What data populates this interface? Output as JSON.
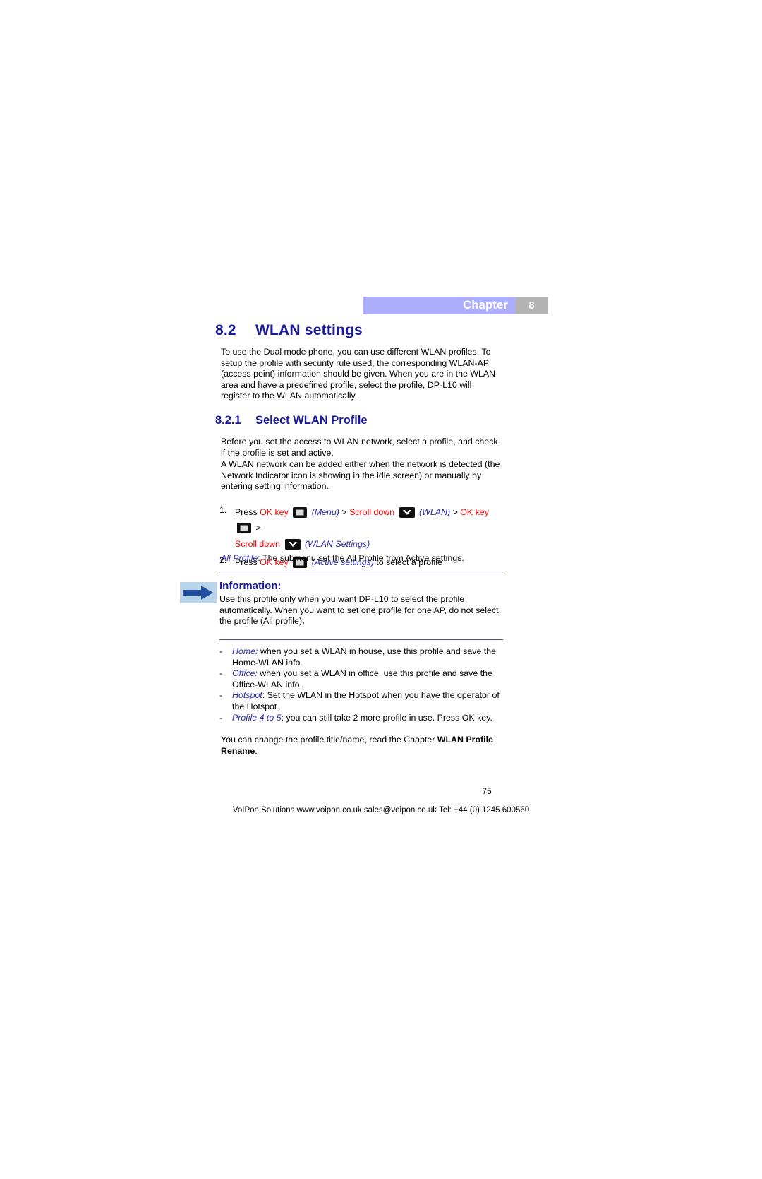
{
  "banner": {
    "label": "Chapter",
    "number": "8",
    "bar_color": "#aeaeff",
    "num_box_color": "#b3b3b3"
  },
  "headings": {
    "h2_number": "8.2",
    "h2_title": "WLAN settings",
    "h3_number": "8.2.1",
    "h3_title": "Select WLAN Profile",
    "heading_color": "#1a1a9c"
  },
  "intro_paragraph": "To use the Dual mode phone, you can use different WLAN profiles. To setup the profile with security rule used, the corresponding WLAN-AP (access point) information should be given. When you are in the WLAN area and have a predefined profile, select the profile, DP-L10 will register to the WLAN automatically.",
  "sub_paragraph_1": "Before you set the access to WLAN network, select a profile, and check if the profile is set and active.",
  "sub_paragraph_2": "A WLAN network can be added either when the network is detected (the Network Indicator icon is showing in the idle screen) or manually by entering setting information.",
  "steps": {
    "step1": {
      "number": "1.",
      "press": "Press",
      "ok_key": "OK key",
      "menu": "(Menu)",
      "gt1": ">",
      "scroll_down_1": "Scroll down",
      "wlan": "(WLAN)",
      "gt2": ">",
      "ok_key_2": "OK key",
      "gt3": ">",
      "scroll_down_2": "Scroll down",
      "wlan_settings": "(WLAN Settings)"
    },
    "step2": {
      "number": "2.",
      "press": "Press",
      "ok_key": "OK key",
      "active_settings": "(Active settings)",
      "tail": "to select a profile"
    },
    "all_profile_label": "All Profile",
    "all_profile_text": ": The submenu set the All Profile from Active settings.",
    "red_color": "#ff0000",
    "blue_color": "#2a2ab0"
  },
  "information": {
    "title": "Information:",
    "body": "Use this profile only when you want DP-L10 to select the profile automatically. When you want to set one profile for one AP, do not select the profile (All profile)",
    "body_tail": ".",
    "arrow_bg": "#b9d3e8",
    "arrow_color": "#1f4e9c"
  },
  "bullets": [
    {
      "dash": "-",
      "term": "Home:",
      "text": " when you set a WLAN in house, use this profile and save the Home-WLAN info."
    },
    {
      "dash": "-",
      "term": "Office:",
      "text": " when you set a WLAN in office, use this profile and save the Office-WLAN info."
    },
    {
      "dash": "-",
      "term": "Hotspot",
      "text": ": Set the WLAN in the Hotspot when you have the operator of the Hotspot."
    },
    {
      "dash": "-",
      "term": "Profile 4 to 5",
      "text": ": you can still take 2 more profile in use. Press OK key."
    }
  ],
  "closing": {
    "text_before": "You can change the profile title/name, read the Chapter ",
    "bold_text": "WLAN Profile Rename",
    "text_after": "."
  },
  "footer": {
    "page_number": "75",
    "line": "VoIPon Solutions www.voipon.co.uk sales@voipon.co.uk Tel: +44 (0) 1245 600560"
  },
  "icons": {
    "ok_key": "ok-key-icon",
    "scroll_down": "scroll-down-icon",
    "info_arrow": "right-arrow-icon"
  }
}
